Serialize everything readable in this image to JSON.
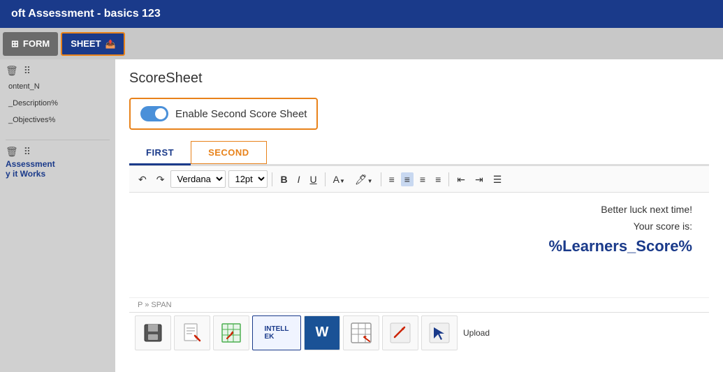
{
  "titleBar": {
    "title": "oft Assessment - basics 123"
  },
  "tabs": [
    {
      "id": "form",
      "label": "FORM",
      "icon": "⊞",
      "active": false
    },
    {
      "id": "sheet",
      "label": "SHEET",
      "icon": "⬆",
      "active": true
    }
  ],
  "sidebar": {
    "items": [
      {
        "label": "ontent_N"
      },
      {
        "label": "_Description%"
      },
      {
        "label": "_Objectives%"
      }
    ],
    "bottomItems": [
      {
        "label": "Assessment"
      },
      {
        "label": "y it Works"
      }
    ]
  },
  "panel": {
    "title": "ScoreSheet",
    "toggleLabel": "Enable Second Score Sheet",
    "toggleEnabled": true,
    "subTabs": [
      {
        "id": "first",
        "label": "FIRST",
        "active": true
      },
      {
        "id": "second",
        "label": "SECOND",
        "selected": true
      }
    ],
    "toolbar": {
      "font": "Verdana",
      "size": "12pt"
    },
    "editorContent": {
      "line1": "Better luck next time!",
      "line2": "Your score is:",
      "variable": "%Learners_Score%"
    },
    "statusBar": "P » SPAN"
  },
  "bottomIcons": [
    {
      "id": "save",
      "unicode": "💾"
    },
    {
      "id": "doc1",
      "unicode": "📄"
    },
    {
      "id": "doc2",
      "unicode": "📊"
    },
    {
      "id": "intellek",
      "label": "INTELLEK"
    },
    {
      "id": "word",
      "unicode": "W"
    },
    {
      "id": "table",
      "unicode": "⊞"
    },
    {
      "id": "arrow",
      "unicode": "↗"
    },
    {
      "id": "cursor",
      "unicode": "↖"
    }
  ],
  "uploadLabel": "Upload"
}
